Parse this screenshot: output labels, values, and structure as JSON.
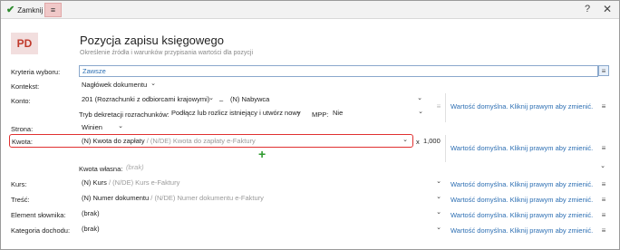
{
  "toolbar": {
    "close_label": "Zamknij",
    "menu_icon": "≡",
    "help_icon": "?",
    "close_icon": "✕"
  },
  "header": {
    "badge": "PD",
    "title": "Pozycja zapisu księgowego",
    "subtitle": "Określenie źródła i warunków przypisania wartości dla pozycji"
  },
  "form": {
    "kryteria": {
      "label": "Kryteria wyboru:",
      "value": "Zawsze"
    },
    "kontekst": {
      "label": "Kontekst:",
      "value": "Nagłówek dokumentu"
    },
    "konto": {
      "label": "Konto:",
      "account": "201 (Rozrachunki z odbiorcami krajowymi)",
      "separator": "–",
      "sub": "(N) Nabywca"
    },
    "tryb": {
      "label": "Tryb dekretacji rozrachunków:",
      "value": "Podłącz lub rozlicz istniejący i utwórz nowy",
      "mpp_label": "MPP:",
      "mpp_value": "Nie"
    },
    "strona": {
      "label": "Strona:",
      "value": "Winien"
    },
    "kwota": {
      "label": "Kwota:",
      "value_main": "(N) Kwota do zapłaty",
      "value_alt": " / (N/DE) Kwota do zapłaty e-Faktury",
      "multiplier_x": "x",
      "multiplier": "1,000"
    },
    "kwota_wlasna": {
      "label": "Kwota własna:",
      "placeholder": "(brak)"
    },
    "kurs": {
      "label": "Kurs:",
      "value_main": "(N) Kurs",
      "value_alt": " / (N/DE) Kurs e-Faktury"
    },
    "tresc": {
      "label": "Treść:",
      "value_main": "(N) Numer dokumentu",
      "value_alt": " / (N/DE) Numer dokumentu e-Faktury"
    },
    "element": {
      "label": "Element słownika:",
      "value": "(brak)"
    },
    "kategoria": {
      "label": "Kategoria dochodu:",
      "value": "(brak)"
    }
  },
  "default_link": "Wartość domyślna. Kliknij prawym aby zmienić.",
  "colors": {
    "accent": "#2d6fb3",
    "highlight": "#e03030",
    "badge_bg": "#f2dede",
    "badge_fg": "#c0392b"
  }
}
